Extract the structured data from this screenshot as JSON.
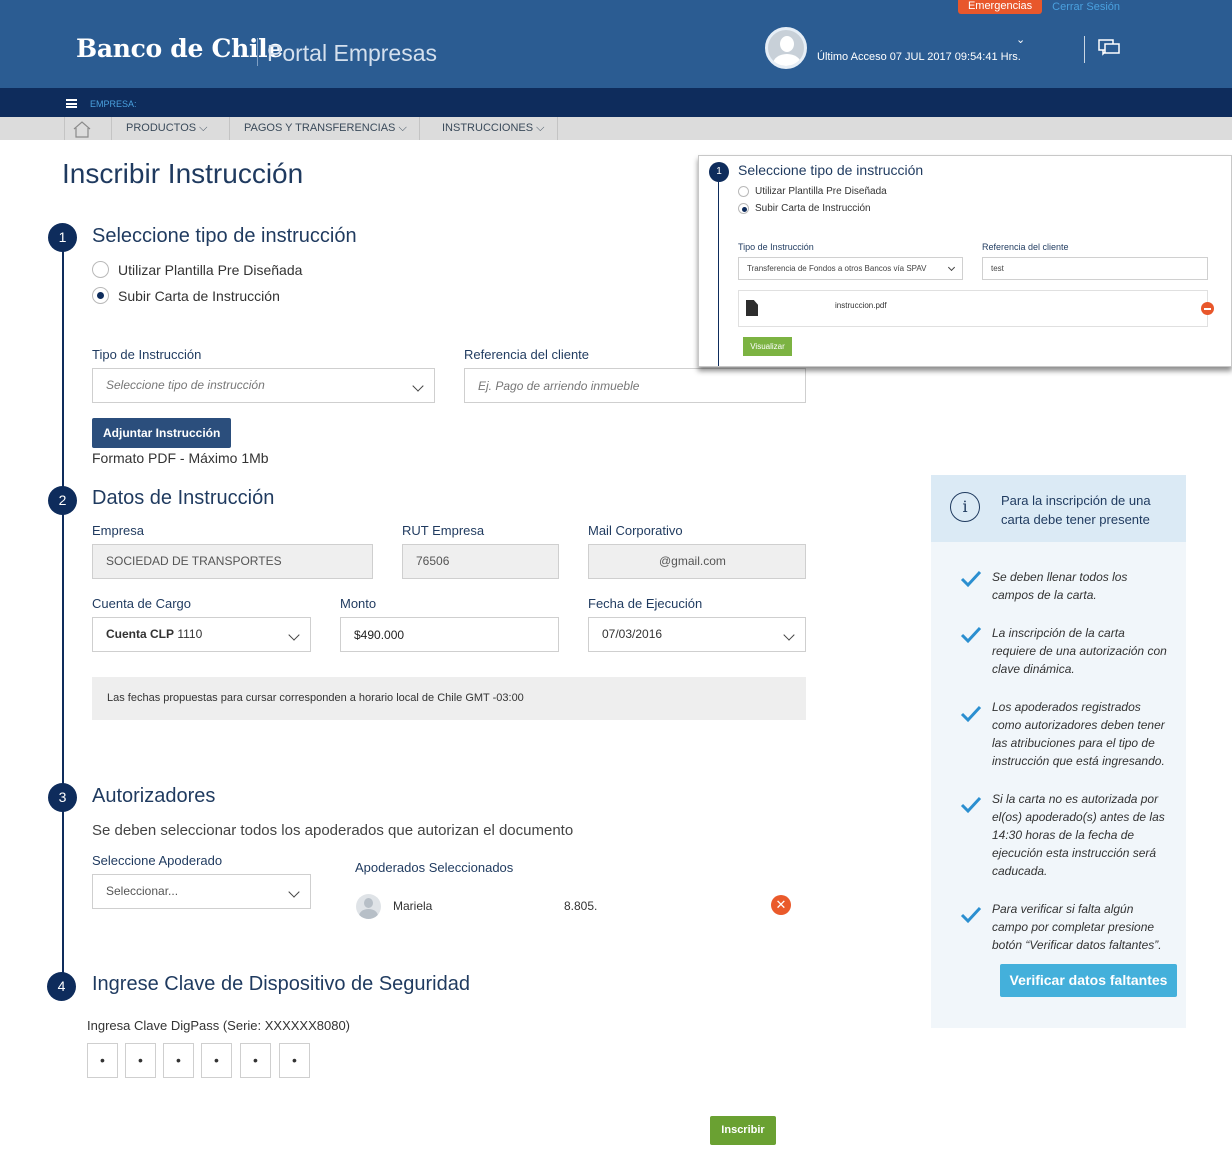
{
  "header": {
    "emergency_label": "Emergencias",
    "logout_label": "Cerrar Sesión",
    "brand": "Banco de Chile",
    "portal": "Portal Empresas",
    "last_access": "Último Acceso 07 JUL 2017 09:54:41 Hrs."
  },
  "empresa_bar": {
    "label": "EMPRESA:"
  },
  "nav": {
    "items": [
      "PRODUCTOS",
      "PAGOS Y TRANSFERENCIAS",
      "INSTRUCCIONES"
    ]
  },
  "page": {
    "title": "Inscribir Instrucción"
  },
  "step1": {
    "number": "1",
    "title": "Seleccione tipo de instrucción",
    "option_template": "Utilizar Plantilla Pre Diseñada",
    "option_upload": "Subir Carta de Instrucción",
    "selected": "upload",
    "type_label": "Tipo de Instrucción",
    "type_placeholder": "Seleccione tipo de instrucción",
    "ref_label": "Referencia del cliente",
    "ref_placeholder": "Ej. Pago de arriendo inmueble",
    "attach_button": "Adjuntar Instrucción",
    "format_note": "Formato PDF - Máximo 1Mb"
  },
  "step2": {
    "number": "2",
    "title": "Datos de Instrucción",
    "empresa_label": "Empresa",
    "empresa_value": "SOCIEDAD DE TRANSPORTES",
    "rut_label": "RUT Empresa",
    "rut_value": "76506",
    "mail_label": "Mail Corporativo",
    "mail_value": "@gmail.com",
    "cuenta_label": "Cuenta de Cargo",
    "cuenta_bold": "Cuenta CLP",
    "cuenta_value": "1110",
    "monto_label": "Monto",
    "monto_value": "$490.000",
    "fecha_label": "Fecha de Ejecución",
    "fecha_value": "07/03/2016",
    "notice": "Las fechas propuestas para cursar corresponden a horario local de Chile GMT -03:00"
  },
  "step3": {
    "number": "3",
    "title": "Autorizadores",
    "subtitle": "Se deben seleccionar todos los apoderados que autorizan el documento",
    "select_label": "Seleccione Apoderado",
    "select_placeholder": "Seleccionar...",
    "selected_label": "Apoderados Seleccionados",
    "selected_name": "Mariela",
    "selected_rut": "8.805."
  },
  "step4": {
    "number": "4",
    "title": "Ingrese Clave de Dispositivo de Seguridad",
    "digipass_label": "Ingresa Clave DigPass (Serie: XXXXXX8080)",
    "pins": [
      "•",
      "•",
      "•",
      "•",
      "•",
      "•"
    ]
  },
  "submit_label": "Inscribir",
  "info": {
    "heading": "Para la inscripción de una carta debe tener presente",
    "tips": [
      "Se deben llenar todos los campos de la carta.",
      "La inscripción de la carta requiere de una autorización con clave dinámica.",
      "Los apoderados registrados como autorizadores deben tener las atribuciones para el tipo de instrucción que está ingresando.",
      "Si la carta no es autorizada por el(os) apoderado(s) antes de las 14:30 horas de la fecha de ejecución esta instrucción será caducada.",
      "Para verificar si falta algún campo por completar presione botón “Verificar datos faltantes”."
    ],
    "button": "Verificar datos faltantes"
  },
  "inset": {
    "number": "1",
    "title": "Seleccione tipo de instrucción",
    "option_template": "Utilizar Plantilla Pre Diseñada",
    "option_upload": "Subir Carta de Instrucción",
    "type_label": "Tipo de Instrucción",
    "type_value": "Transferencia de Fondos a otros Bancos vía SPAV",
    "ref_label": "Referencia del cliente",
    "ref_value": "test",
    "file_name": "instruccion.pdf",
    "view_button": "Visualizar"
  },
  "colors": {
    "header_bg": "#2b5c92",
    "navy": "#0e2c5c",
    "emergency": "#e8572b",
    "green": "#6aa132",
    "info_blue": "#44b0db"
  }
}
